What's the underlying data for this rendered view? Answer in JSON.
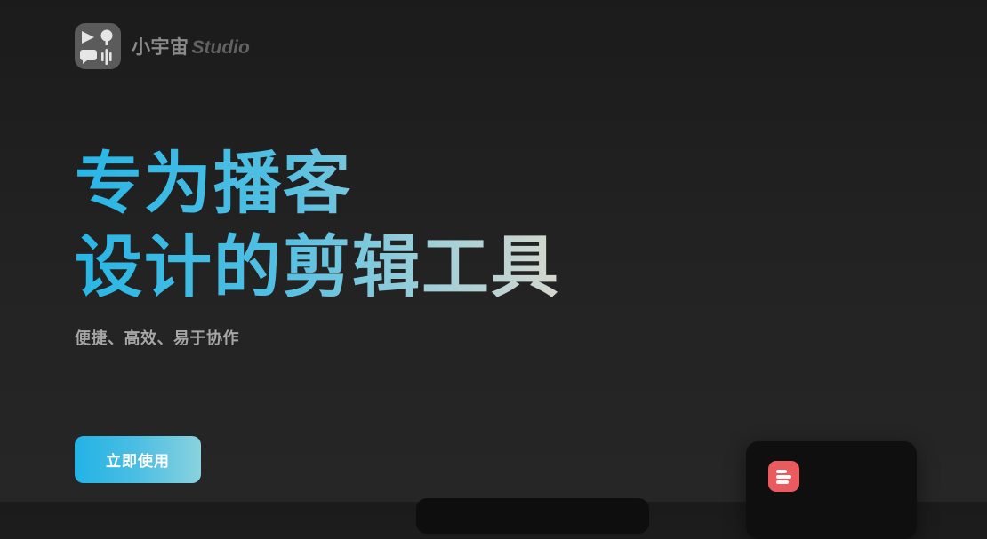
{
  "brand": {
    "name_cn": "小宇宙",
    "name_en": "Studio",
    "logo_icon": "podcast-studio-logo-icon"
  },
  "hero": {
    "title_line1": "专为播客",
    "title_line2": "设计的剪辑工具",
    "subtitle": "便捷、高效、易于协作",
    "gradient_colors": [
      "#28b6e6",
      "#9fcfd8",
      "#ddd8cb"
    ]
  },
  "cta": {
    "label": "立即使用",
    "color": "#23b3e6"
  },
  "preview": {
    "app_icon": "menu-lines-icon",
    "app_icon_color": "#ea5a5e"
  },
  "colors": {
    "background": "#222222",
    "brand_text": "#8a8a8a",
    "subtitle_text": "#a6a6a6"
  }
}
